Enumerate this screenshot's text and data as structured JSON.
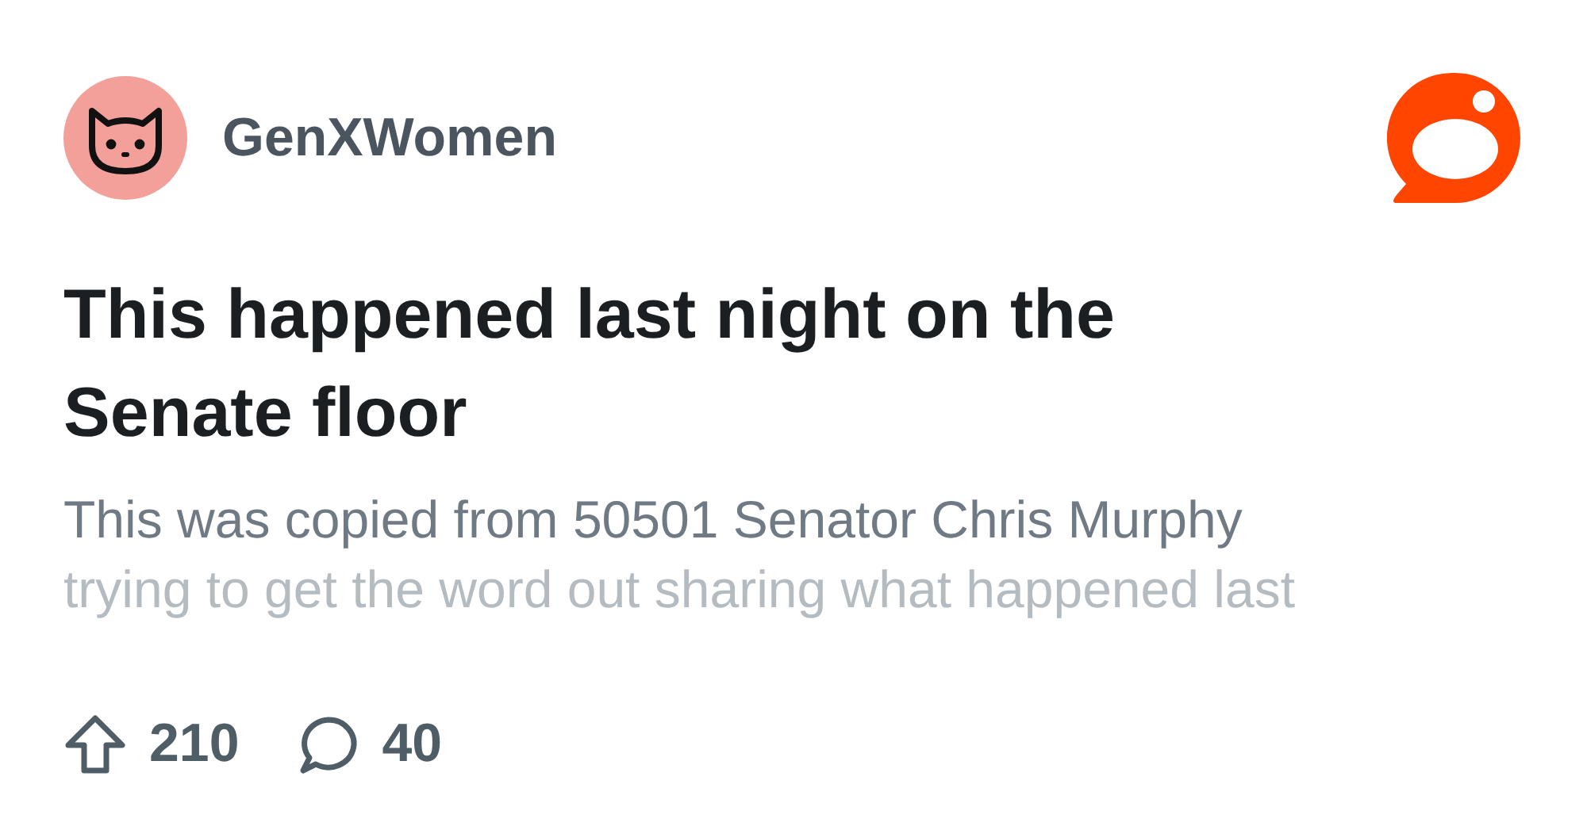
{
  "community": {
    "name": "GenXWomen"
  },
  "post": {
    "title": "This happened last night on the Senate floor",
    "body_lines": [
      "This was copied from 50501 Senator Chris Murphy",
      "trying to get the word out sharing what happened last"
    ]
  },
  "stats": {
    "upvotes": "210",
    "comments": "40"
  }
}
